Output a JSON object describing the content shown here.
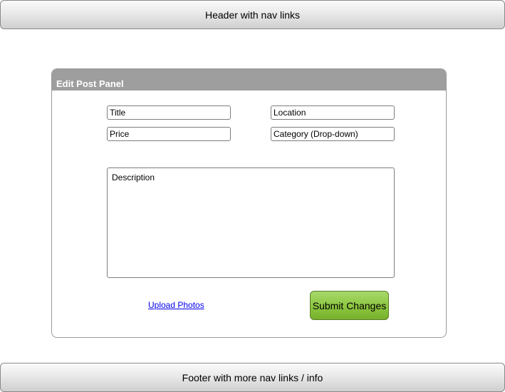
{
  "header": {
    "text": "Header with nav links"
  },
  "panel": {
    "title": "Edit Post Panel",
    "fields": {
      "title_placeholder": "Title",
      "location_placeholder": "Location",
      "price_placeholder": "Price",
      "category_placeholder": "Category (Drop-down)",
      "description_placeholder": "Description"
    },
    "upload_link": "Upload Photos",
    "submit_label": "Submit Changes"
  },
  "footer": {
    "text": "Footer with more nav links / info"
  },
  "colors": {
    "panel_header": "#9e9e9e",
    "submit_green": "#8cc63f",
    "link_blue": "#0000ee"
  }
}
